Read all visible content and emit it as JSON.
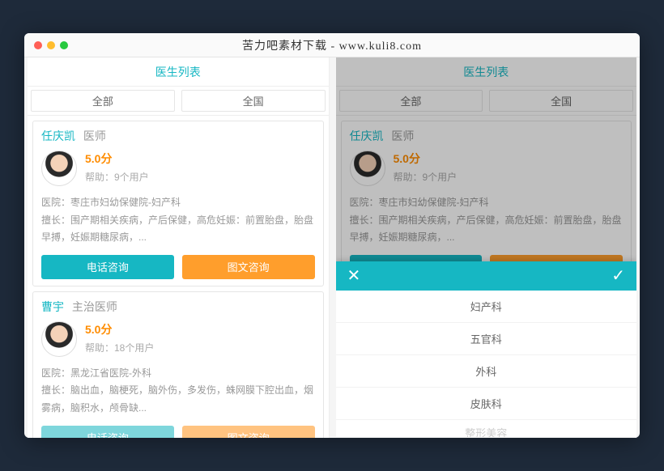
{
  "window_title": "苦力吧素材下载 - www.kuli8.com",
  "header": "医生列表",
  "tabs": [
    "全部",
    "全国"
  ],
  "doctors": [
    {
      "name": "任庆凯",
      "role": "医师",
      "score": "5.0分",
      "help": "帮助：9个用户",
      "hospital": "医院：枣庄市妇幼保健院-妇产科",
      "skill": "擅长：围产期相关疾病，产后保健，高危妊娠：前置胎盘，胎盘早搏，妊娠期糖尿病，...",
      "btn1": "电话咨询",
      "btn2": "图文咨询"
    },
    {
      "name": "曹宇",
      "role": "主治医师",
      "score": "5.0分",
      "help": "帮助：18个用户",
      "hospital": "医院：黑龙江省医院-外科",
      "skill": "擅长：脑出血，脑梗死，脑外伤，多发伤，蛛网膜下腔出血，烟雾病，脑积水，颅骨缺...",
      "btn1": "电话咨询",
      "btn2": "图文咨询"
    }
  ],
  "sheet_items": [
    "妇产科",
    "五官科",
    "外科",
    "皮肤科",
    "整形美容"
  ]
}
